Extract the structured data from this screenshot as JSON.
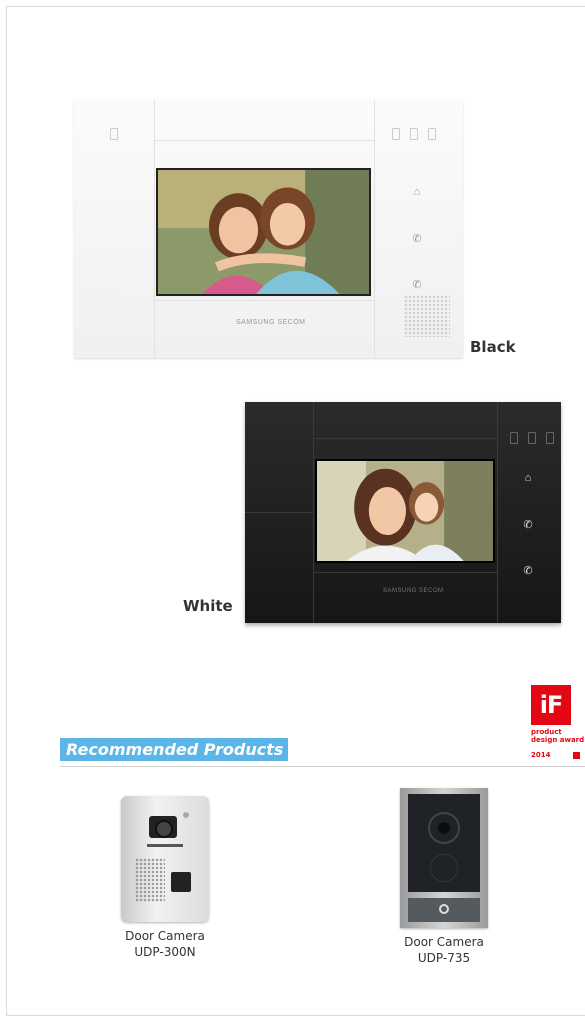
{
  "monitors": {
    "white_label": "Black",
    "black_label": "White",
    "brand_text": "SAMSUNG SECOM"
  },
  "award": {
    "logo": "iF",
    "line1": "product",
    "line2": "design award",
    "year": "2014",
    "color": "#e30613"
  },
  "recommended": {
    "title": "Recommended Products",
    "accent_color": "#5bb5e6",
    "products": [
      {
        "name": "Door Camera",
        "model": "UDP-300N"
      },
      {
        "name": "Door Camera",
        "model": "UDP-735"
      }
    ]
  }
}
